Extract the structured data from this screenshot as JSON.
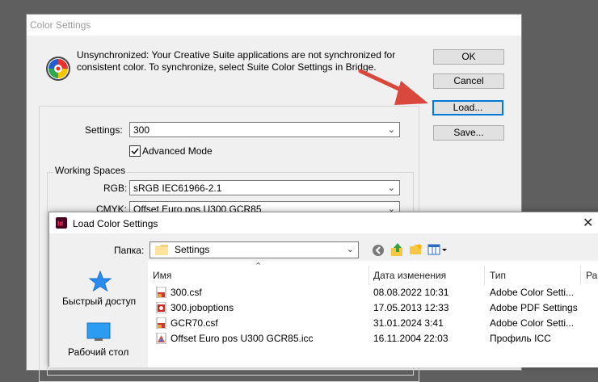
{
  "color_settings": {
    "title": "Color Settings",
    "warning": "Unsynchronized: Your Creative Suite applications are not synchronized for consistent color. To synchronize, select Suite Color Settings in Bridge.",
    "buttons": {
      "ok": "OK",
      "cancel": "Cancel",
      "load": "Load...",
      "save": "Save..."
    },
    "settings_label": "Settings:",
    "settings_value": "300",
    "advanced_mode_label": "Advanced Mode",
    "advanced_mode_checked": true,
    "working_spaces_label": "Working Spaces",
    "rgb_label": "RGB:",
    "rgb_value": "sRGB IEC61966-2.1",
    "cmyk_label": "CMYK:",
    "cmyk_value": "Offset Euro pos U300 GCR85"
  },
  "load_dialog": {
    "title": "Load Color Settings",
    "folder_label": "Папка:",
    "folder_value": "Settings",
    "sidebar": [
      {
        "label": "Быстрый доступ",
        "icon": "star-icon"
      },
      {
        "label": "Рабочий стол",
        "icon": "desktop-icon"
      }
    ],
    "columns": {
      "name": "Имя",
      "date": "Дата изменения",
      "type": "Тип",
      "size": "Ра"
    },
    "files": [
      {
        "name": "300.csf",
        "date": "08.08.2022 10:31",
        "type": "Adobe Color Setti...",
        "icon": "csf-file-icon"
      },
      {
        "name": "300.joboptions",
        "date": "17.05.2013 12:33",
        "type": "Adobe PDF Settings",
        "icon": "pdf-settings-file-icon"
      },
      {
        "name": "GCR70.csf",
        "date": "31.01.2024 3:41",
        "type": "Adobe Color Setti...",
        "icon": "csf-file-icon"
      },
      {
        "name": "Offset Euro pos U300 GCR85.icc",
        "date": "16.11.2004 22:03",
        "type": "Профиль ICC",
        "icon": "icc-file-icon"
      }
    ]
  }
}
